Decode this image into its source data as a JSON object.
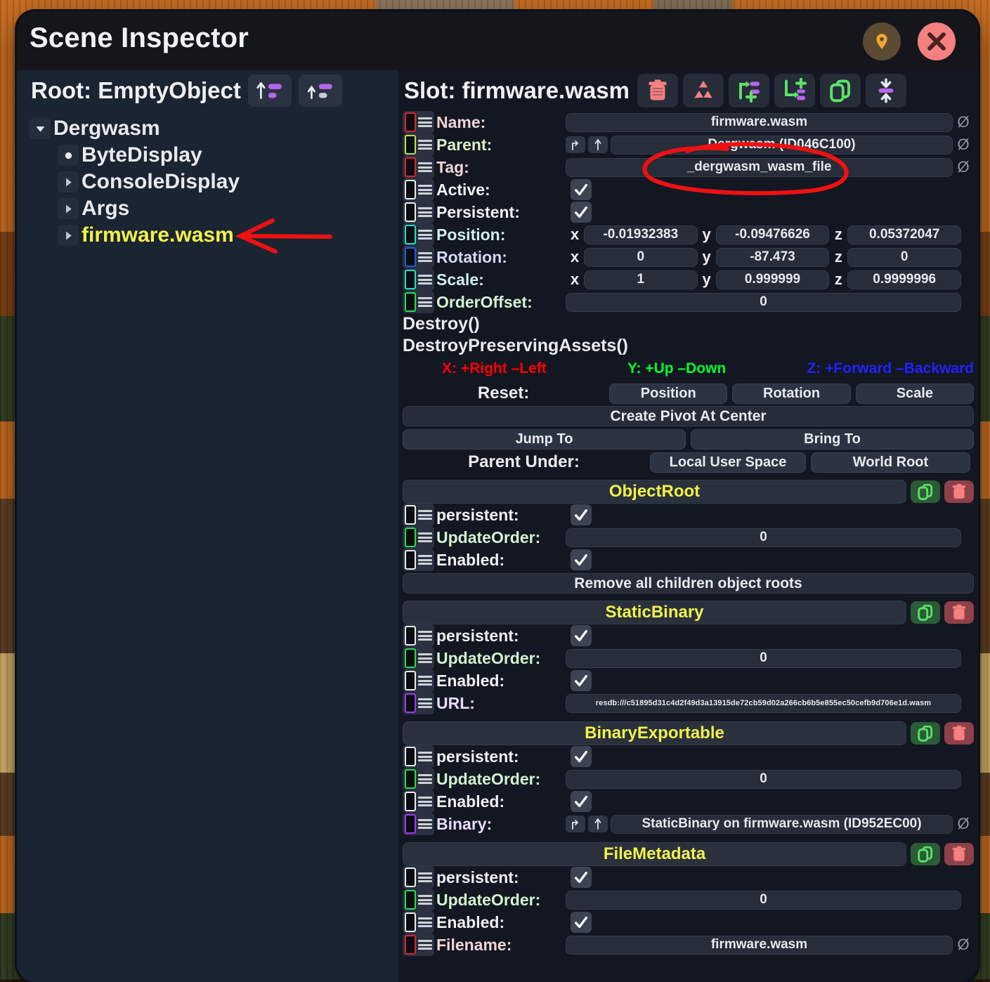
{
  "window": {
    "title": "Scene Inspector",
    "pin_icon": "pin-icon",
    "close_icon": "close-icon"
  },
  "left_panel": {
    "root_label": "Root: EmptyObject",
    "header_buttons": [
      {
        "name": "move-up-button",
        "icon": "arrow-up-list-icon"
      },
      {
        "name": "move-into-button",
        "icon": "arrow-up-small-list-icon"
      }
    ],
    "tree": [
      {
        "label": "Dergwasm",
        "depth": 0,
        "twisty": "open",
        "selected": false
      },
      {
        "label": "ByteDisplay",
        "depth": 1,
        "twisty": "dot",
        "selected": false
      },
      {
        "label": "ConsoleDisplay",
        "depth": 1,
        "twisty": "closed",
        "selected": false
      },
      {
        "label": "Args",
        "depth": 1,
        "twisty": "closed",
        "selected": false
      },
      {
        "label": "firmware.wasm",
        "depth": 1,
        "twisty": "closed",
        "selected": true
      }
    ]
  },
  "right_panel": {
    "slot_label": "Slot: firmware.wasm",
    "toolbar": [
      {
        "name": "destroy-slot-button",
        "icon": "trash-icon"
      },
      {
        "name": "destroy-preserving-button",
        "icon": "recycle-icon"
      },
      {
        "name": "add-child-slot-button",
        "icon": "arrow-branch-plus-icon"
      },
      {
        "name": "add-sibling-slot-button",
        "icon": "arrow-corner-plus-icon"
      },
      {
        "name": "duplicate-slot-button",
        "icon": "copy-icon"
      },
      {
        "name": "collapse-expand-button",
        "icon": "arrows-collapse-icon"
      }
    ],
    "fields": [
      {
        "name": "name",
        "label": "Name:",
        "chip": "#d8252a",
        "label_color": "#f0d4d6",
        "type": "text",
        "value": "firmware.wasm",
        "nullable": true
      },
      {
        "name": "parent",
        "label": "Parent:",
        "chip": "#bfe04a",
        "label_color": "#d9f0c4",
        "type": "ref",
        "value": "Dergwasm (ID046C100)",
        "nullable": true
      },
      {
        "name": "tag",
        "label": "Tag:",
        "chip": "#d8252a",
        "label_color": "#f0d4d6",
        "type": "text",
        "value": "_dergwasm_wasm_file",
        "nullable": true
      },
      {
        "name": "active",
        "label": "Active:",
        "chip": "#e9ecef",
        "label_color": "#eef0f3",
        "type": "bool",
        "value": true
      },
      {
        "name": "persistent",
        "label": "Persistent:",
        "chip": "#e9ecef",
        "label_color": "#eef0f3",
        "type": "bool",
        "value": true
      }
    ],
    "vectors": [
      {
        "name": "position",
        "label": "Position:",
        "chip": "#25dfc6",
        "label_color": "#cdeeee",
        "x": "-0.01932383",
        "y": "-0.09476626",
        "z": "0.05372047"
      },
      {
        "name": "rotation",
        "label": "Rotation:",
        "chip": "#1f5de0",
        "label_color": "#d3dbf2",
        "x": "0",
        "y": "-87.473",
        "z": "0"
      },
      {
        "name": "scale",
        "label": "Scale:",
        "chip": "#25dfc6",
        "label_color": "#cdeeee",
        "x": "1",
        "y": "0.999999",
        "z": "0.9999996"
      }
    ],
    "order_offset": {
      "name": "orderoffset",
      "label": "OrderOffset:",
      "chip": "#22e04a",
      "label_color": "#d2f3cf",
      "value": "0"
    },
    "functions": [
      "Destroy()",
      "DestroyPreservingAssets()"
    ],
    "axis_legend": [
      {
        "text": "X: +Right –Left",
        "color": "#ff0000"
      },
      {
        "text": "Y: +Up –Down",
        "color": "#00ff2a"
      },
      {
        "text": "Z: +Forward –Backward",
        "color": "#2222ff"
      }
    ],
    "reset_label": "Reset:",
    "reset_buttons": [
      "Position",
      "Rotation",
      "Scale"
    ],
    "create_pivot_button": "Create Pivot At Center",
    "jump_to_button": "Jump To",
    "bring_to_button": "Bring To",
    "parent_under_label": "Parent Under:",
    "parent_under_buttons": [
      "Local User Space",
      "World Root"
    ],
    "axis_x_label": "x",
    "axis_y_label": "y",
    "axis_z_label": "z",
    "null_glyph": "Ø",
    "components": [
      {
        "name": "objectroot",
        "title": "ObjectRoot",
        "rows": [
          {
            "name": "persistent",
            "label": "persistent:",
            "chip": "#e9ecef",
            "label_color": "#eef0f3",
            "type": "bool",
            "value": true
          },
          {
            "name": "updateorder",
            "label": "UpdateOrder:",
            "chip": "#22e04a",
            "label_color": "#d2f3cf",
            "type": "num",
            "value": "0"
          },
          {
            "name": "enabled",
            "label": "Enabled:",
            "chip": "#e9ecef",
            "label_color": "#eef0f3",
            "type": "bool",
            "value": true
          }
        ],
        "footer_button": "Remove all children object roots"
      },
      {
        "name": "staticbinary",
        "title": "StaticBinary",
        "rows": [
          {
            "name": "persistent",
            "label": "persistent:",
            "chip": "#e9ecef",
            "label_color": "#eef0f3",
            "type": "bool",
            "value": true
          },
          {
            "name": "updateorder",
            "label": "UpdateOrder:",
            "chip": "#22e04a",
            "label_color": "#d2f3cf",
            "type": "num",
            "value": "0"
          },
          {
            "name": "enabled",
            "label": "Enabled:",
            "chip": "#e9ecef",
            "label_color": "#eef0f3",
            "type": "bool",
            "value": true
          },
          {
            "name": "url",
            "label": "URL:",
            "chip": "#a238f0",
            "label_color": "#e8dcf5",
            "type": "url",
            "value": "resdb:///c51895d31c4d2f49d3a13915de72cb59d02a266cb6b5e855ec50cefb9d706e1d.wasm"
          }
        ]
      },
      {
        "name": "binaryexportable",
        "title": "BinaryExportable",
        "rows": [
          {
            "name": "persistent",
            "label": "persistent:",
            "chip": "#e9ecef",
            "label_color": "#eef0f3",
            "type": "bool",
            "value": true
          },
          {
            "name": "updateorder",
            "label": "UpdateOrder:",
            "chip": "#22e04a",
            "label_color": "#d2f3cf",
            "type": "num",
            "value": "0"
          },
          {
            "name": "enabled",
            "label": "Enabled:",
            "chip": "#e9ecef",
            "label_color": "#eef0f3",
            "type": "bool",
            "value": true
          },
          {
            "name": "binary",
            "label": "Binary:",
            "chip": "#a238f0",
            "label_color": "#e8dcf5",
            "type": "ref",
            "value": "StaticBinary on firmware.wasm (ID952EC00)",
            "nullable": true
          }
        ]
      },
      {
        "name": "filemetadata",
        "title": "FileMetadata",
        "rows": [
          {
            "name": "persistent",
            "label": "persistent:",
            "chip": "#e9ecef",
            "label_color": "#eef0f3",
            "type": "bool",
            "value": true
          },
          {
            "name": "updateorder",
            "label": "UpdateOrder:",
            "chip": "#22e04a",
            "label_color": "#d2f3cf",
            "type": "num",
            "value": "0"
          },
          {
            "name": "enabled",
            "label": "Enabled:",
            "chip": "#e9ecef",
            "label_color": "#eef0f3",
            "type": "bool",
            "value": true
          },
          {
            "name": "filename",
            "label": "Filename:",
            "chip": "#d8252a",
            "label_color": "#f0d4d6",
            "type": "text",
            "value": "firmware.wasm",
            "nullable": true
          }
        ]
      }
    ]
  },
  "annotations": {
    "color": "#ee1111",
    "ellipse_target": "tag-value-field",
    "arrow_target": "tree-item-firmware-wasm"
  },
  "environment": {
    "wood": "#c4681c",
    "wood_dark": "#7a3d10",
    "foliage": "#2f3a1c",
    "tan": "#cfae63",
    "brown": "#5b3a1e"
  }
}
